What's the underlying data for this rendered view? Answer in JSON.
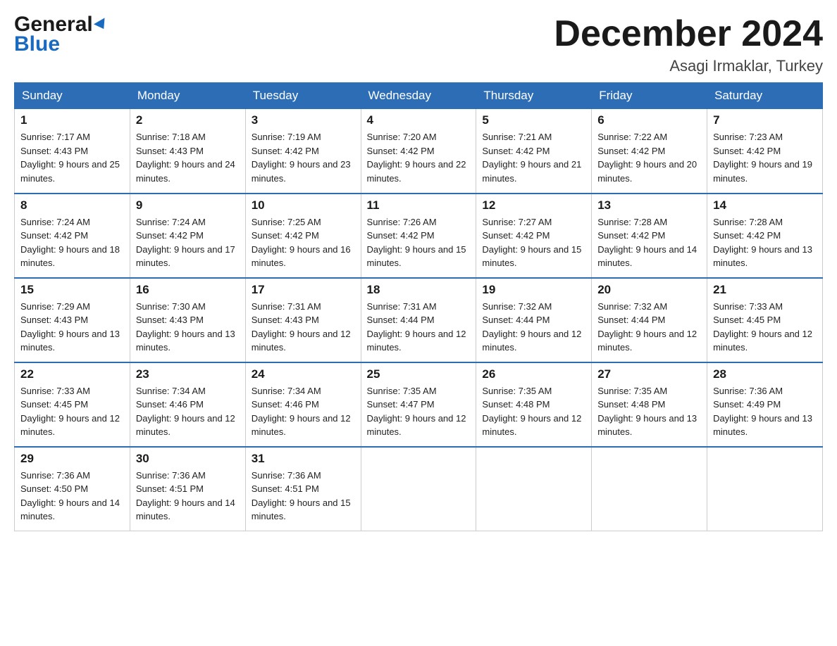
{
  "header": {
    "logo_line1": "General",
    "logo_line2": "Blue",
    "month_title": "December 2024",
    "location": "Asagi Irmaklar, Turkey"
  },
  "calendar": {
    "days_of_week": [
      "Sunday",
      "Monday",
      "Tuesday",
      "Wednesday",
      "Thursday",
      "Friday",
      "Saturday"
    ],
    "weeks": [
      [
        {
          "day": "1",
          "sunrise": "7:17 AM",
          "sunset": "4:43 PM",
          "daylight": "9 hours and 25 minutes."
        },
        {
          "day": "2",
          "sunrise": "7:18 AM",
          "sunset": "4:43 PM",
          "daylight": "9 hours and 24 minutes."
        },
        {
          "day": "3",
          "sunrise": "7:19 AM",
          "sunset": "4:42 PM",
          "daylight": "9 hours and 23 minutes."
        },
        {
          "day": "4",
          "sunrise": "7:20 AM",
          "sunset": "4:42 PM",
          "daylight": "9 hours and 22 minutes."
        },
        {
          "day": "5",
          "sunrise": "7:21 AM",
          "sunset": "4:42 PM",
          "daylight": "9 hours and 21 minutes."
        },
        {
          "day": "6",
          "sunrise": "7:22 AM",
          "sunset": "4:42 PM",
          "daylight": "9 hours and 20 minutes."
        },
        {
          "day": "7",
          "sunrise": "7:23 AM",
          "sunset": "4:42 PM",
          "daylight": "9 hours and 19 minutes."
        }
      ],
      [
        {
          "day": "8",
          "sunrise": "7:24 AM",
          "sunset": "4:42 PM",
          "daylight": "9 hours and 18 minutes."
        },
        {
          "day": "9",
          "sunrise": "7:24 AM",
          "sunset": "4:42 PM",
          "daylight": "9 hours and 17 minutes."
        },
        {
          "day": "10",
          "sunrise": "7:25 AM",
          "sunset": "4:42 PM",
          "daylight": "9 hours and 16 minutes."
        },
        {
          "day": "11",
          "sunrise": "7:26 AM",
          "sunset": "4:42 PM",
          "daylight": "9 hours and 15 minutes."
        },
        {
          "day": "12",
          "sunrise": "7:27 AM",
          "sunset": "4:42 PM",
          "daylight": "9 hours and 15 minutes."
        },
        {
          "day": "13",
          "sunrise": "7:28 AM",
          "sunset": "4:42 PM",
          "daylight": "9 hours and 14 minutes."
        },
        {
          "day": "14",
          "sunrise": "7:28 AM",
          "sunset": "4:42 PM",
          "daylight": "9 hours and 13 minutes."
        }
      ],
      [
        {
          "day": "15",
          "sunrise": "7:29 AM",
          "sunset": "4:43 PM",
          "daylight": "9 hours and 13 minutes."
        },
        {
          "day": "16",
          "sunrise": "7:30 AM",
          "sunset": "4:43 PM",
          "daylight": "9 hours and 13 minutes."
        },
        {
          "day": "17",
          "sunrise": "7:31 AM",
          "sunset": "4:43 PM",
          "daylight": "9 hours and 12 minutes."
        },
        {
          "day": "18",
          "sunrise": "7:31 AM",
          "sunset": "4:44 PM",
          "daylight": "9 hours and 12 minutes."
        },
        {
          "day": "19",
          "sunrise": "7:32 AM",
          "sunset": "4:44 PM",
          "daylight": "9 hours and 12 minutes."
        },
        {
          "day": "20",
          "sunrise": "7:32 AM",
          "sunset": "4:44 PM",
          "daylight": "9 hours and 12 minutes."
        },
        {
          "day": "21",
          "sunrise": "7:33 AM",
          "sunset": "4:45 PM",
          "daylight": "9 hours and 12 minutes."
        }
      ],
      [
        {
          "day": "22",
          "sunrise": "7:33 AM",
          "sunset": "4:45 PM",
          "daylight": "9 hours and 12 minutes."
        },
        {
          "day": "23",
          "sunrise": "7:34 AM",
          "sunset": "4:46 PM",
          "daylight": "9 hours and 12 minutes."
        },
        {
          "day": "24",
          "sunrise": "7:34 AM",
          "sunset": "4:46 PM",
          "daylight": "9 hours and 12 minutes."
        },
        {
          "day": "25",
          "sunrise": "7:35 AM",
          "sunset": "4:47 PM",
          "daylight": "9 hours and 12 minutes."
        },
        {
          "day": "26",
          "sunrise": "7:35 AM",
          "sunset": "4:48 PM",
          "daylight": "9 hours and 12 minutes."
        },
        {
          "day": "27",
          "sunrise": "7:35 AM",
          "sunset": "4:48 PM",
          "daylight": "9 hours and 13 minutes."
        },
        {
          "day": "28",
          "sunrise": "7:36 AM",
          "sunset": "4:49 PM",
          "daylight": "9 hours and 13 minutes."
        }
      ],
      [
        {
          "day": "29",
          "sunrise": "7:36 AM",
          "sunset": "4:50 PM",
          "daylight": "9 hours and 14 minutes."
        },
        {
          "day": "30",
          "sunrise": "7:36 AM",
          "sunset": "4:51 PM",
          "daylight": "9 hours and 14 minutes."
        },
        {
          "day": "31",
          "sunrise": "7:36 AM",
          "sunset": "4:51 PM",
          "daylight": "9 hours and 15 minutes."
        },
        null,
        null,
        null,
        null
      ]
    ]
  }
}
